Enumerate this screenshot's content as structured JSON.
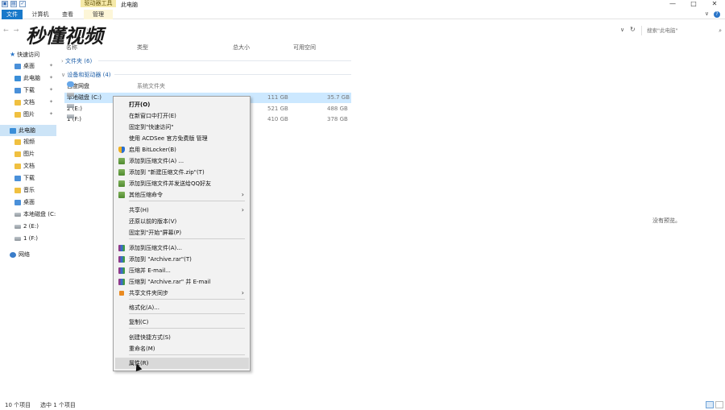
{
  "window": {
    "title": "此电脑",
    "context_tab_label": "驱动器工具",
    "controls": {
      "minimize": "—",
      "maximize": "□",
      "close": "✕"
    }
  },
  "ribbon": {
    "tabs": [
      "文件",
      "计算机",
      "查看",
      "管理"
    ],
    "expand_glyph": "∨",
    "help_glyph": "?"
  },
  "address": {
    "path": "此电脑",
    "search_placeholder": "搜索\"此电脑\""
  },
  "logo_text": "秒懂视频",
  "sidebar": {
    "items": [
      {
        "label": "快速访问",
        "icon": "star-icon",
        "pinned": false,
        "selected": false
      },
      {
        "label": "桌面",
        "icon": "desktop-folder-icon",
        "pinned": true,
        "selected": false
      },
      {
        "label": "此电脑",
        "icon": "pc-icon",
        "pinned": true,
        "selected": false
      },
      {
        "label": "下载",
        "icon": "download-folder-icon",
        "pinned": true,
        "selected": false
      },
      {
        "label": "文档",
        "icon": "documents-folder-icon",
        "pinned": true,
        "selected": false
      },
      {
        "label": "图片",
        "icon": "pictures-folder-icon",
        "pinned": true,
        "selected": false
      },
      {
        "label": "此电脑",
        "icon": "pc-icon",
        "pinned": false,
        "selected": true
      },
      {
        "label": "视频",
        "icon": "videos-folder-icon",
        "pinned": false,
        "selected": false
      },
      {
        "label": "图片",
        "icon": "pictures-folder-icon",
        "pinned": false,
        "selected": false
      },
      {
        "label": "文档",
        "icon": "documents-folder-icon",
        "pinned": false,
        "selected": false
      },
      {
        "label": "下载",
        "icon": "download-folder-icon",
        "pinned": false,
        "selected": false
      },
      {
        "label": "音乐",
        "icon": "music-folder-icon",
        "pinned": false,
        "selected": false
      },
      {
        "label": "桌面",
        "icon": "desktop-folder-icon",
        "pinned": false,
        "selected": false
      },
      {
        "label": "本地磁盘 (C:",
        "icon": "drive-icon",
        "pinned": false,
        "selected": false
      },
      {
        "label": "2 (E:)",
        "icon": "drive-icon",
        "pinned": false,
        "selected": false
      },
      {
        "label": "1 (F:)",
        "icon": "drive-icon",
        "pinned": false,
        "selected": false
      },
      {
        "label": "网络",
        "icon": "network-icon",
        "pinned": false,
        "selected": false
      }
    ],
    "pin_glyph": "✦"
  },
  "content": {
    "columns": [
      "名称",
      "类型",
      "总大小",
      "可用空间"
    ],
    "folders_group": "文件夹 (6)",
    "devices_group": "设备和驱动器 (4)",
    "rows": [
      {
        "name": "百度网盘",
        "type": "系统文件夹",
        "total": "",
        "free": "",
        "icon": "cloud-drive-icon",
        "selected": false
      },
      {
        "name": "本地磁盘 (C:)",
        "type": "",
        "total": "111 GB",
        "free": "35.7 GB",
        "icon": "drive-icon",
        "selected": true
      },
      {
        "name": "2 (E:)",
        "type": "",
        "total": "521 GB",
        "free": "488 GB",
        "icon": "drive-icon",
        "selected": false
      },
      {
        "name": "1 (F:)",
        "type": "",
        "total": "410 GB",
        "free": "378 GB",
        "icon": "drive-icon",
        "selected": false
      }
    ],
    "preview_text": "没有预览。"
  },
  "status": {
    "item_count": "10 个项目",
    "selected_count": "选中 1 个项目"
  },
  "context_menu": {
    "items": [
      {
        "label": "打开(O)",
        "bold": true
      },
      {
        "label": "在新窗口中打开(E)"
      },
      {
        "label": "固定到\"快速访问\""
      },
      {
        "label": "使用 ACDSee 官方免费版 管理"
      },
      {
        "label": "启用 BitLocker(B)",
        "icon": "shield"
      },
      {
        "label": "添加到压缩文件(A) ...",
        "icon": "zip"
      },
      {
        "label": "添加到 \"新建压缩文件.zip\"(T)",
        "icon": "zip"
      },
      {
        "label": "添加到压缩文件并发送给QQ好友",
        "icon": "zip"
      },
      {
        "label": "其他压缩命令",
        "icon": "zip",
        "submenu": true
      },
      {
        "label": "共享(H)",
        "submenu": true
      },
      {
        "label": "还原以前的版本(V)"
      },
      {
        "label": "固定到\"开始\"屏幕(P)"
      },
      {
        "label": "添加到压缩文件(A)...",
        "icon": "rar"
      },
      {
        "label": "添加到 \"Archive.rar\"(T)",
        "icon": "rar"
      },
      {
        "label": "压缩并 E-mail...",
        "icon": "rar"
      },
      {
        "label": "压缩到 \"Archive.rar\" 并 E-mail",
        "icon": "rar"
      },
      {
        "label": "共享文件夹同步",
        "icon": "sync",
        "submenu": true
      },
      {
        "label": "格式化(A)..."
      },
      {
        "label": "复制(C)"
      },
      {
        "label": "创建快捷方式(S)"
      },
      {
        "label": "重命名(M)"
      },
      {
        "label": "属性(R)",
        "hover": true
      }
    ],
    "submenu_glyph": "›"
  }
}
